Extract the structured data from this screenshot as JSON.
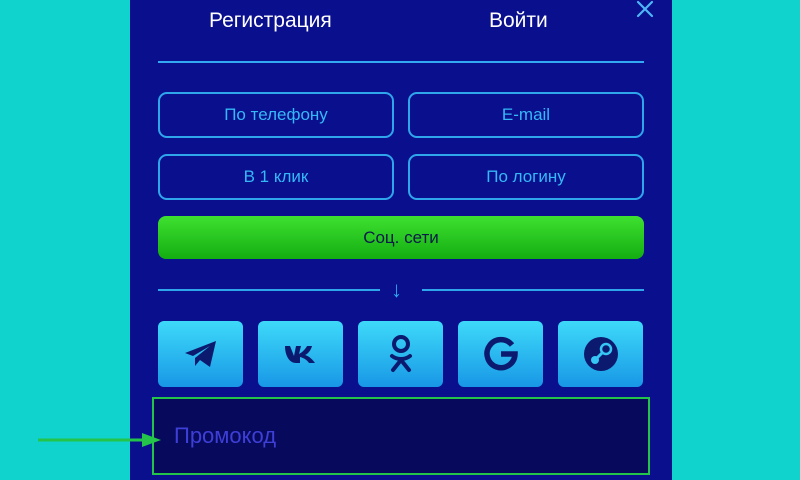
{
  "tabs": {
    "register": "Регистрация",
    "login": "Войти"
  },
  "methods": [
    {
      "label": "По телефону"
    },
    {
      "label": "E-mail"
    },
    {
      "label": "В 1 клик"
    },
    {
      "label": "По логину"
    }
  ],
  "social_button": {
    "label": "Соц. сети",
    "color": "#2fc61f"
  },
  "divider_arrow": "↓",
  "social_icons": [
    "telegram-icon",
    "vk-icon",
    "odnoklassniki-icon",
    "google-icon",
    "steam-icon"
  ],
  "promo": {
    "placeholder": "Промокод"
  },
  "colors": {
    "panel": "#0a0f8e",
    "page_bg": "#0fd3cc",
    "accent": "#2fa6ec",
    "highlight": "#24c34a"
  }
}
